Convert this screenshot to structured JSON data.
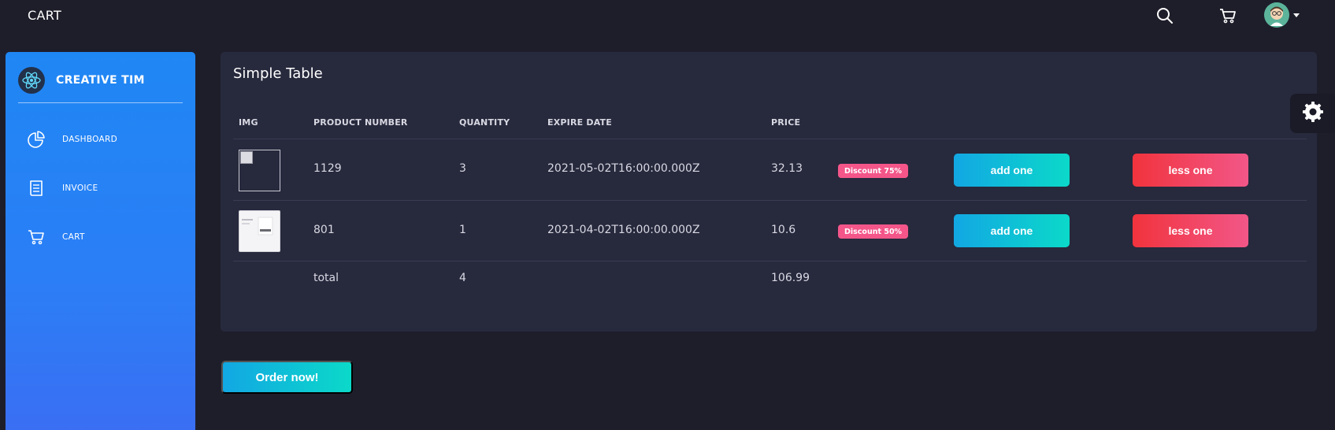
{
  "topbar": {
    "brand": "CART",
    "icons": [
      "search-icon",
      "cart-icon",
      "avatar"
    ]
  },
  "sidebar": {
    "brand": "CREATIVE TIM",
    "items": [
      {
        "label": "DASHBOARD",
        "icon": "pie-chart-icon"
      },
      {
        "label": "INVOICE",
        "icon": "receipt-icon"
      },
      {
        "label": "CART",
        "icon": "cart-icon"
      }
    ]
  },
  "card": {
    "title": "Simple Table",
    "columns": [
      "IMG",
      "PRODUCT NUMBER",
      "QUANTITY",
      "EXPIRE DATE",
      "PRICE"
    ],
    "rows": [
      {
        "product_number": "1129",
        "quantity": "3",
        "expire_date": "2021-05-02T16:00:00.000Z",
        "price": "32.13",
        "discount": "Discount 75%",
        "add_label": "add one",
        "less_label": "less one"
      },
      {
        "product_number": "801",
        "quantity": "1",
        "expire_date": "2021-04-02T16:00:00.000Z",
        "price": "10.6",
        "discount": "Discount 50%",
        "add_label": "add one",
        "less_label": "less one"
      }
    ],
    "total": {
      "label": "total",
      "quantity": "4",
      "price": "106.99"
    }
  },
  "order_button": "Order now!",
  "colors": {
    "background": "#1e1e2b",
    "card": "#27293d",
    "sidebar_gradient_start": "#1f87f4",
    "add_gradient": [
      "#12a7e3",
      "#0bd9c9"
    ],
    "less_gradient": [
      "#f1333d",
      "#f25788"
    ],
    "badge": "#f4568a"
  }
}
